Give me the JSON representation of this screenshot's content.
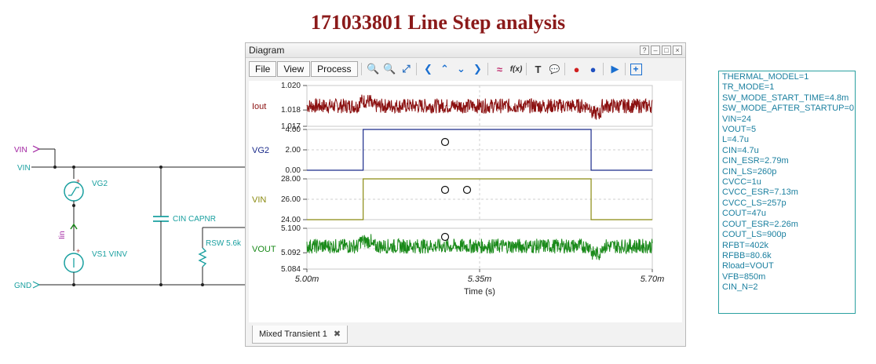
{
  "page": {
    "title": "171033801 Line Step analysis"
  },
  "schematic": {
    "labels": {
      "vin_pin": "VIN",
      "vin_net": "VIN",
      "gnd_net": "GND",
      "vg2": "VG2",
      "vs1": "VS1 VINV",
      "iin": "Iin",
      "cin": "CIN CAPNR",
      "rsw": "RSW 5.6k"
    }
  },
  "window": {
    "title": "Diagram",
    "buttons": [
      "?",
      "–",
      "□",
      "×"
    ],
    "menu": {
      "file": "File",
      "view": "View",
      "process": "Process"
    },
    "tab_label": "Mixed Transient 1",
    "tab_close": "✖"
  },
  "toolbar_icons": {
    "zoom_in": "🔍",
    "zoom_out": "🔍",
    "fit": "⤢",
    "left": "❮",
    "up": "⌃",
    "down": "⌄",
    "right": "❯",
    "wave": "≈",
    "fx": "f(x)",
    "text": "T",
    "comment": "💬",
    "marker1": "●",
    "marker2": "●",
    "play": "▶",
    "add": "+"
  },
  "chart_data": {
    "type": "line",
    "xlabel": "Time (s)",
    "x_ticks": [
      "5.00m",
      "5.35m",
      "5.70m"
    ],
    "xlim": [
      5.0,
      5.7
    ],
    "panels": [
      {
        "name": "Iout",
        "color": "#8b1010",
        "ylim": [
          1.017,
          1.02
        ],
        "yticks": [
          "1.020",
          "1.018",
          "1.017"
        ],
        "shape": "noise",
        "base": 1.0185
      },
      {
        "name": "VG2",
        "color": "#1a2a8a",
        "ylim": [
          0,
          4
        ],
        "yticks": [
          "4.00",
          "2.00",
          "0.00"
        ],
        "shape": "step",
        "low": 0,
        "high": 4,
        "rise": 5.114,
        "fall": 5.576
      },
      {
        "name": "VIN",
        "color": "#8a8a10",
        "ylim": [
          24,
          28
        ],
        "yticks": [
          "28.00",
          "26.00",
          "24.00"
        ],
        "shape": "step",
        "low": 24,
        "high": 28,
        "rise": 5.114,
        "fall": 5.576
      },
      {
        "name": "VOUT",
        "color": "#1a8a1a",
        "ylim": [
          5.084,
          5.1
        ],
        "yticks": [
          "5.100",
          "5.092",
          "5.084"
        ],
        "shape": "noise",
        "base": 5.093
      }
    ]
  },
  "parameters": [
    "THERMAL_MODEL=1",
    "TR_MODE=1",
    "SW_MODE_START_TIME=4.8m",
    "SW_MODE_AFTER_STARTUP=0",
    "VIN=24",
    "VOUT=5",
    "L=4.7u",
    "CIN=4.7u",
    "CIN_ESR=2.79m",
    "CIN_LS=260p",
    "CVCC=1u",
    "CVCC_ESR=7.13m",
    "CVCC_LS=257p",
    "COUT=47u",
    "COUT_ESR=2.26m",
    "COUT_LS=900p",
    "RFBT=402k",
    "RFBB=80.6k",
    "Rload=VOUT",
    "VFB=850m",
    "CIN_N=2"
  ]
}
